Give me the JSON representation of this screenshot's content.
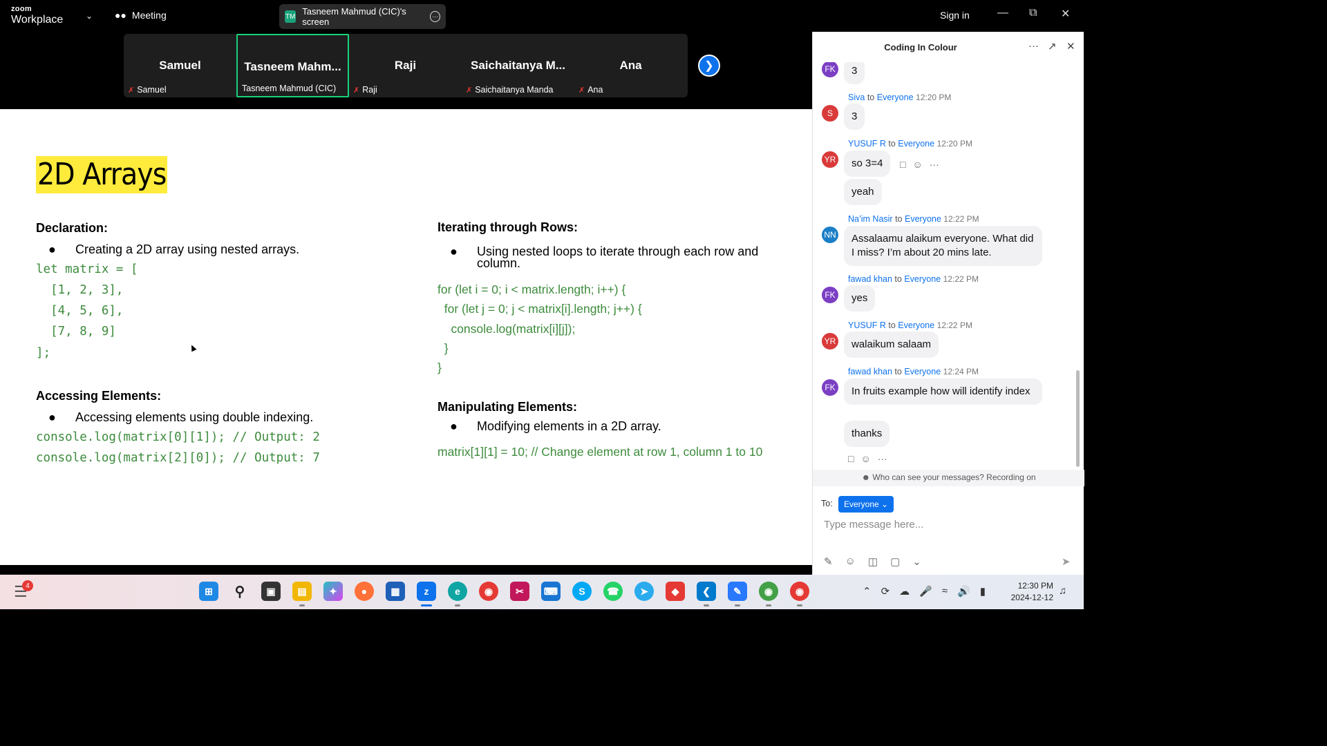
{
  "app": {
    "logo_top": "zoom",
    "logo_bottom": "Workplace",
    "meeting_label": "Meeting",
    "share_badge": "TM",
    "share_label": "Tasneem Mahmud (CIC)'s screen",
    "sign_in": "Sign in"
  },
  "participants": [
    {
      "display": "Samuel",
      "name": "Samuel",
      "muted": true
    },
    {
      "display": "Tasneem  Mahm...",
      "name": "Tasneem Mahmud (CIC)",
      "muted": false,
      "active": true
    },
    {
      "display": "Raji",
      "name": "Raji",
      "muted": true
    },
    {
      "display": "Saichaitanya  M...",
      "name": "Saichaitanya Manda",
      "muted": true
    },
    {
      "display": "Ana",
      "name": "Ana",
      "muted": true
    }
  ],
  "slide": {
    "title": "2D Arrays",
    "declaration": {
      "heading": "Declaration:",
      "bullet": "Creating a 2D array using nested arrays.",
      "code": [
        "let matrix = [",
        "  [1, 2, 3],",
        "  [4, 5, 6],",
        "  [7, 8, 9]",
        "];"
      ]
    },
    "accessing": {
      "heading": "Accessing Elements:",
      "bullet": "Accessing elements using double indexing.",
      "code": [
        "console.log(matrix[0][1]); // Output: 2",
        "console.log(matrix[2][0]); // Output: 7"
      ]
    },
    "iterating": {
      "heading": "Iterating through Rows:",
      "bullet_line1": "Using nested loops to iterate through each row and",
      "bullet_line2": "column.",
      "code": [
        "for (let i = 0; i < matrix.length; i++) {",
        "  for (let j = 0; j < matrix[i].length; j++) {",
        "    console.log(matrix[i][j]);",
        "  }",
        "}"
      ]
    },
    "manipulating": {
      "heading": "Manipulating Elements:",
      "bullet": "Modifying elements in a 2D array.",
      "code": "matrix[1][1] = 10; // Change element at row 1, column 1 to 10"
    }
  },
  "chat": {
    "title": "Coding In Colour",
    "messages": [
      {
        "avatar": "FK",
        "text": "3"
      },
      {
        "avatar": "S",
        "sender": "Siva",
        "to": "Everyone",
        "time": "12:20 PM",
        "text": "3"
      },
      {
        "avatar": "YR",
        "sender": "YUSUF R",
        "to": "Everyone",
        "time": "12:20 PM",
        "text": "so 3=4",
        "text2": "yeah"
      },
      {
        "avatar": "NN",
        "sender": "Na’im Nasir",
        "to": "Everyone",
        "time": "12:22 PM",
        "text": "Assalaamu alaikum everyone. What did I miss? I’m about 20 mins late."
      },
      {
        "avatar": "FK",
        "sender": "fawad khan",
        "to": "Everyone",
        "time": "12:22 PM",
        "text": "yes"
      },
      {
        "avatar": "YR",
        "sender": "YUSUF R",
        "to": "Everyone",
        "time": "12:22 PM",
        "text": "walaikum salaam"
      },
      {
        "avatar": "FK",
        "sender": "fawad khan",
        "to": "Everyone",
        "time": "12:24 PM",
        "text": "In fruits example how will identify index",
        "text2": "thanks"
      }
    ],
    "to_word": "to",
    "privacy": "Who can see your messages? Recording on",
    "to_label": "To:",
    "recipient": "Everyone",
    "placeholder": "Type message here..."
  },
  "taskbar": {
    "notification_count": "4",
    "time": "12:30 PM",
    "date": "2024-12-12"
  },
  "colors": {
    "accent": "#0e72ed",
    "active_tile": "#19d27a",
    "code_green": "#3d8b3d",
    "title_highlight": "#ffeb3b"
  }
}
